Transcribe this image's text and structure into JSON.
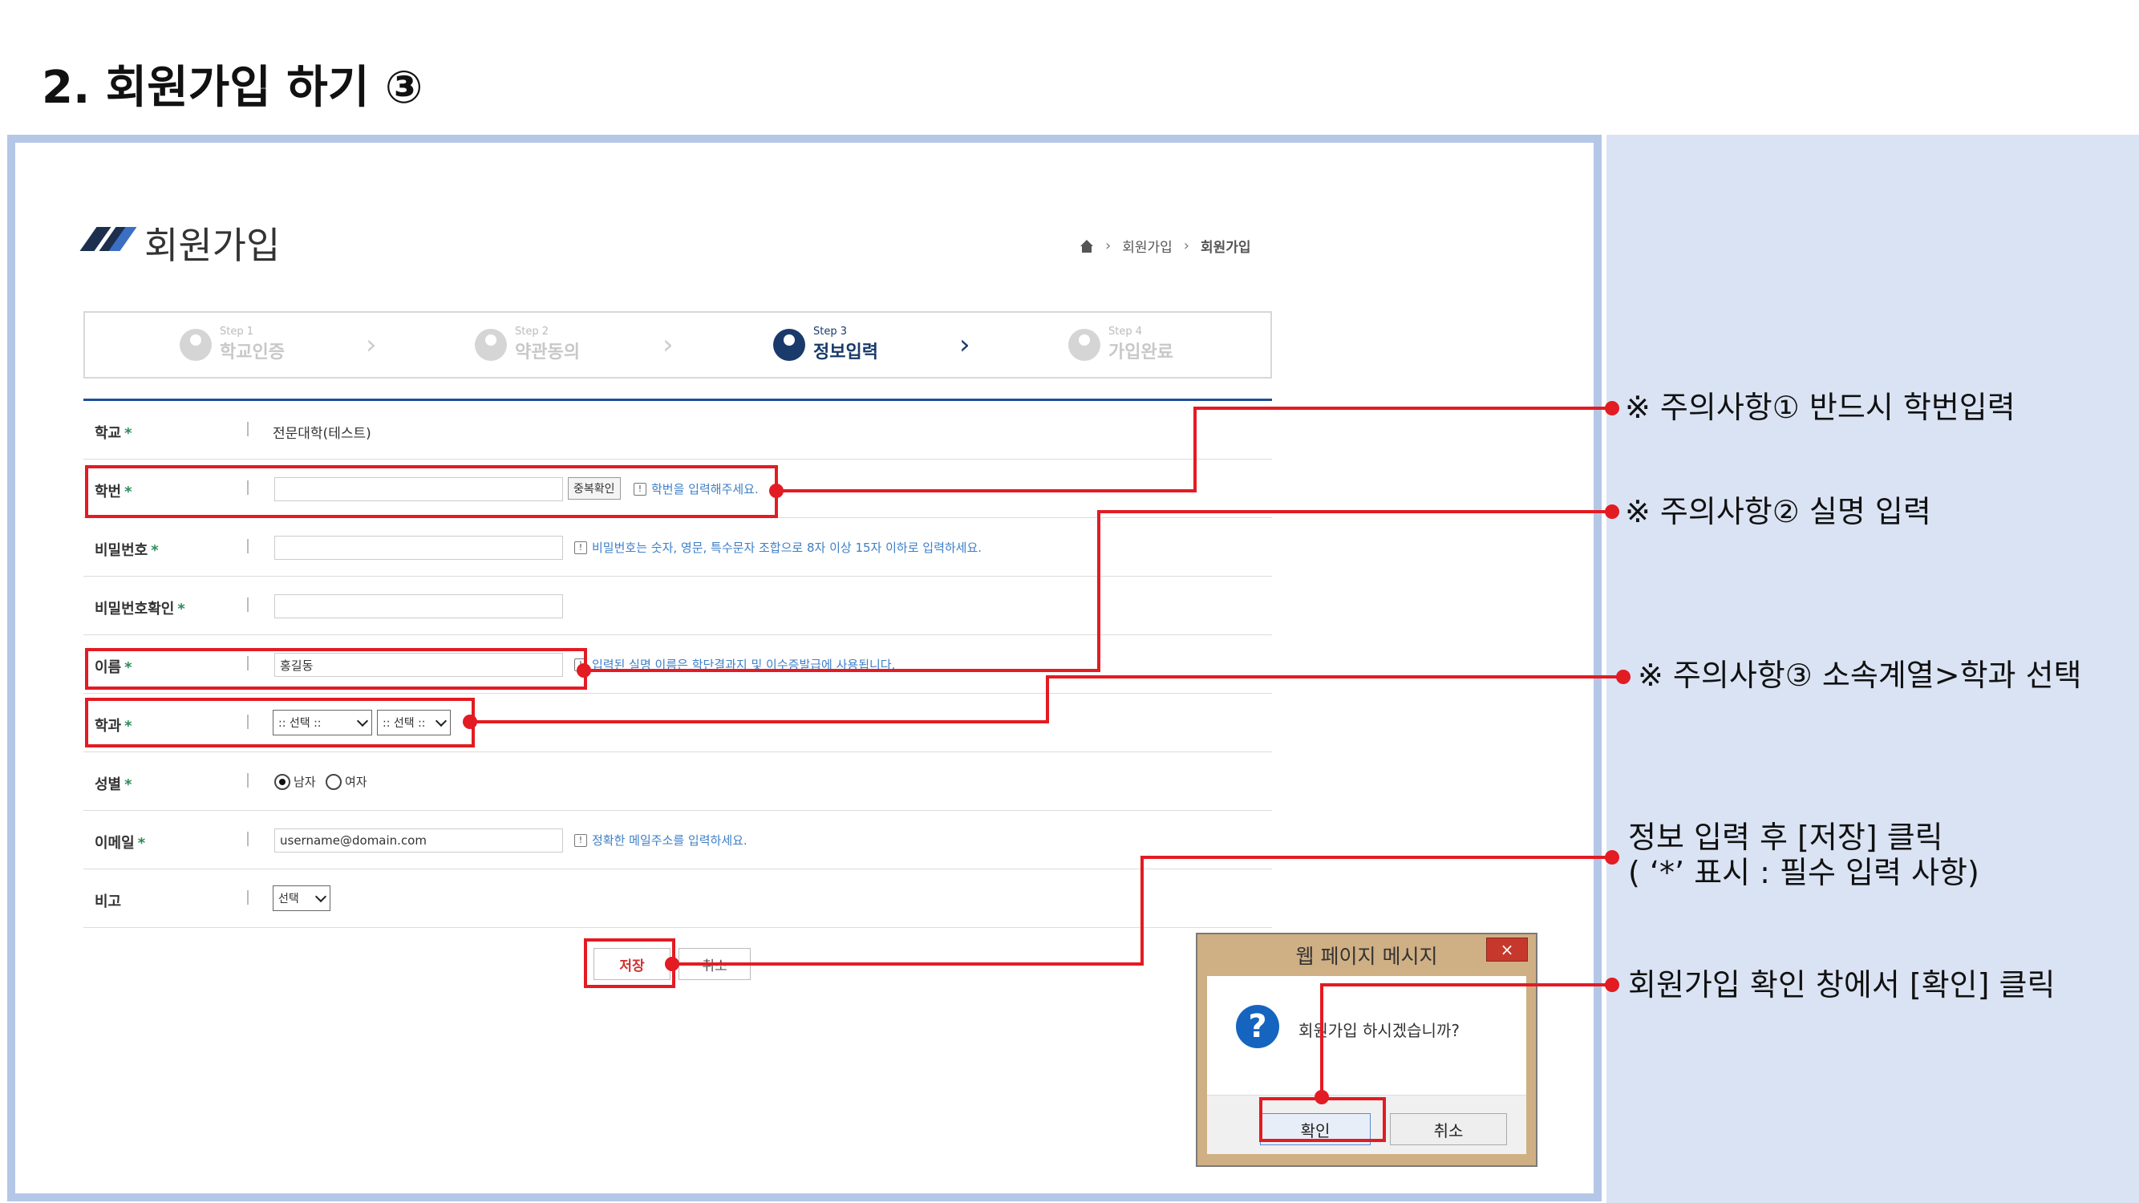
{
  "slide_title": "2. 회원가입 하기 ③",
  "page": {
    "heading": "회원가입",
    "breadcrumb": [
      "회원가입",
      "회원가입"
    ]
  },
  "steps": [
    {
      "num": "Step 1",
      "name": "학교인증",
      "active": false
    },
    {
      "num": "Step 2",
      "name": "약관동의",
      "active": false
    },
    {
      "num": "Step 3",
      "name": "정보입력",
      "active": true
    },
    {
      "num": "Step 4",
      "name": "가입완료",
      "active": false
    }
  ],
  "form": {
    "school": {
      "label": "학교",
      "value": "전문대학(테스트)"
    },
    "student_id": {
      "label": "학번",
      "value": "",
      "dup_check": "중복확인",
      "hint": "학번을 입력해주세요."
    },
    "password": {
      "label": "비밀번호",
      "value": "",
      "hint": "비밀번호는 숫자, 영문, 특수문자 조합으로 8자 이상 15자 이하로 입력하세요."
    },
    "password_confirm": {
      "label": "비밀번호확인",
      "value": ""
    },
    "name": {
      "label": "이름",
      "value": "홍길동",
      "hint": "입력된 실명 이름은 학단결과지 및 이수증발급에 사용됩니다."
    },
    "department": {
      "label": "학과",
      "select1": ":: 선택 ::",
      "select2": ":: 선택 ::"
    },
    "gender": {
      "label": "성별",
      "options": [
        "남자",
        "여자"
      ],
      "selected": "남자"
    },
    "email": {
      "label": "이메일",
      "value": "username@domain.com",
      "hint": "정확한 메일주소를 입력하세요."
    },
    "note": {
      "label": "비고",
      "select": "선택"
    },
    "required_mark": "*",
    "save_label": "저장",
    "cancel_label": "취소"
  },
  "dialog": {
    "title": "웹 페이지 메시지",
    "message": "회원가입 하시겠습니까?",
    "ok_label": "확인",
    "cancel_label": "취소",
    "close_glyph": "×",
    "question_glyph": "?"
  },
  "callouts": {
    "c1": "※ 주의사항① 반드시 학번입력",
    "c2": "※ 주의사항② 실명 입력",
    "c3": "※ 주의사항③ 소속계열>학과 선택",
    "c4_line1": "정보 입력 후 [저장] 클릭",
    "c4_line2": "( ‘*’ 표시 : 필수 입력 사항)",
    "c5": "회원가입 확인 창에서 [확인] 클릭"
  },
  "colors": {
    "highlight": "#e31b23",
    "frame": "#b4c7e7",
    "panel": "#dae3f3",
    "accent": "#1f4e9a"
  }
}
